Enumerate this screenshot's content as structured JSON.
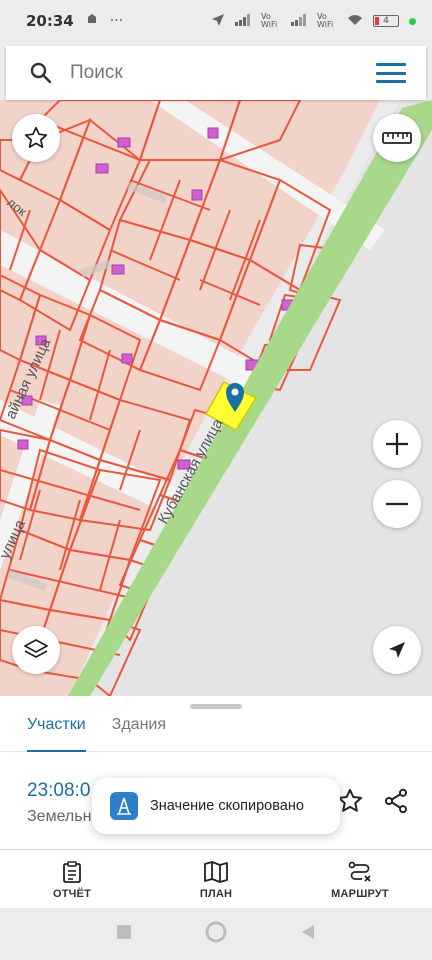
{
  "status_bar": {
    "time": "20:34",
    "battery": "4",
    "network_label_1": "Vo WiFi",
    "network_label_2": "Vo WiFi"
  },
  "search": {
    "placeholder": "Поиск"
  },
  "map": {
    "street_labels": [
      "Кубанская улица",
      "айная улица",
      "улица",
      "лок"
    ],
    "parcel_color": "#e8583f",
    "building_color": "#d05fd2",
    "selected_parcel_color": "#ffff33",
    "marker_color": "#1a6fa3",
    "park_strip_color": "#a8d88a"
  },
  "sheet": {
    "tabs": [
      {
        "label": "Участки",
        "active": true
      },
      {
        "label": "Здания",
        "active": false
      }
    ],
    "parcel_number": "23:08:0",
    "parcel_type": "Земельн"
  },
  "toast": {
    "text": "Значение скопировано"
  },
  "bottom_nav": [
    {
      "label": "ОТЧЁТ",
      "icon": "report-icon"
    },
    {
      "label": "ПЛАН",
      "icon": "map-plan-icon"
    },
    {
      "label": "МАРШРУТ",
      "icon": "route-icon"
    }
  ],
  "colors": {
    "accent": "#1a6fa3"
  }
}
